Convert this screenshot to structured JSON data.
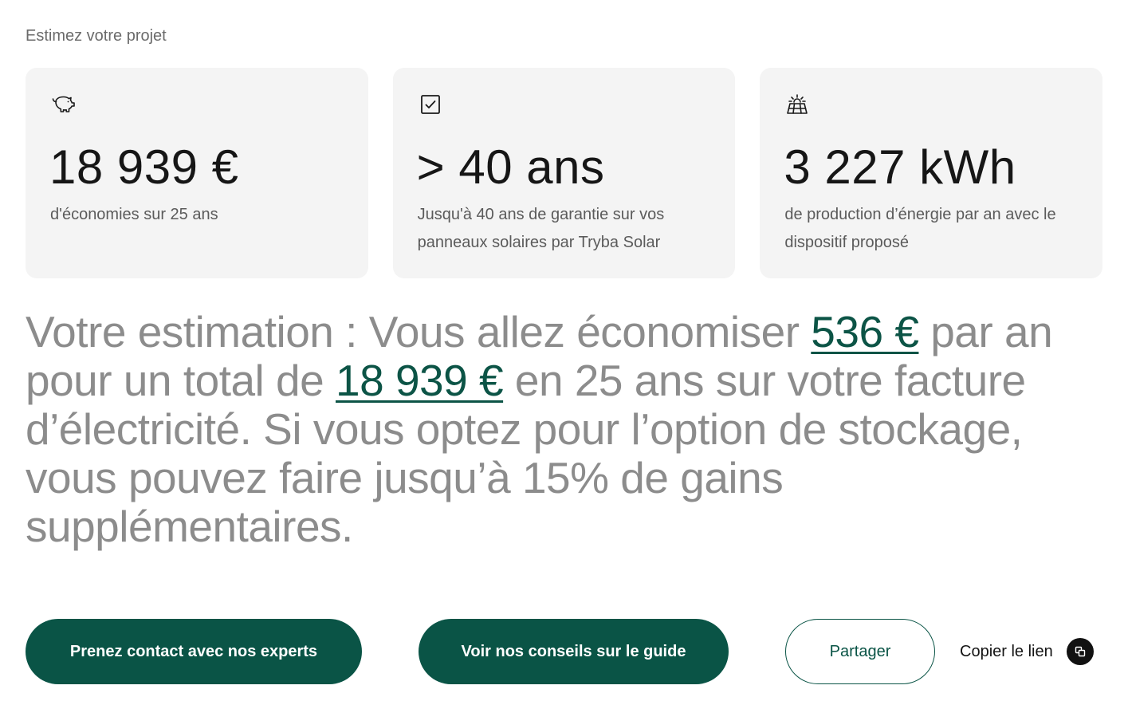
{
  "section_title": "Estimez votre projet",
  "cards": [
    {
      "icon": "piggy-bank-icon",
      "value": "18 939 €",
      "description": "d'économies sur 25 ans"
    },
    {
      "icon": "checkbox-icon",
      "value": "> 40 ans",
      "description": "Jusqu'à 40 ans de garantie sur vos panneaux solaires par Tryba Solar"
    },
    {
      "icon": "solar-panel-icon",
      "value": "3 227 kWh",
      "description": "de production d’énergie par an avec le dispositif proposé"
    }
  ],
  "estimate": {
    "part1": "Votre estimation : Vous allez économiser ",
    "amount_per_year": "536 €",
    "part2": " par an pour un total de ",
    "amount_total": "18 939 €",
    "part3": " en 25 ans sur votre facture d’électricité. Si vous optez pour l’option de stockage, vous pouvez faire jusqu’à 15% de gains supplémentaires."
  },
  "actions": {
    "contact_label": "Prenez contact avec nos experts",
    "guide_label": "Voir nos conseils sur le guide",
    "share_label": "Partager",
    "copy_label": "Copier le lien",
    "copy_icon": "copy-icon"
  },
  "colors": {
    "brand": "#0a5446",
    "card_bg": "#f4f4f4",
    "estimate_text": "#8c8c8c"
  }
}
